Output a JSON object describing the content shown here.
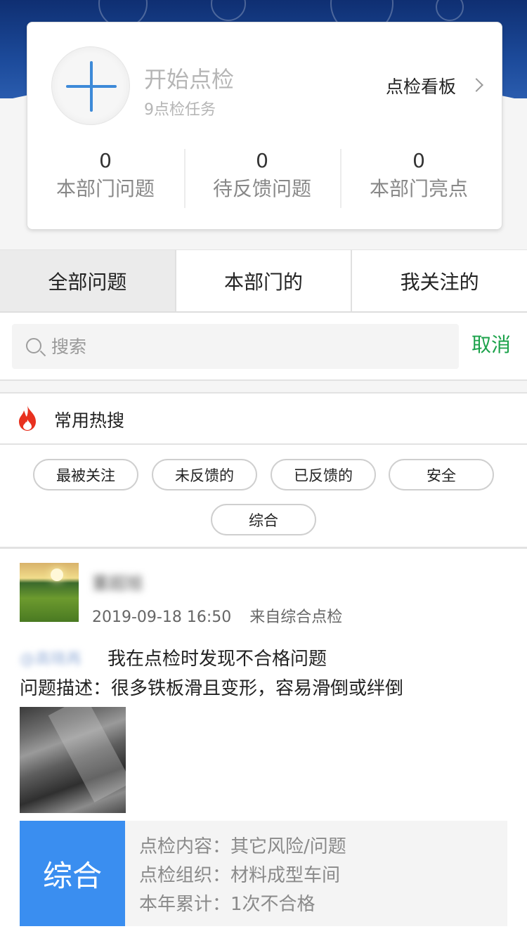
{
  "card": {
    "start_title": "开始点检",
    "task_count": "9点检任务",
    "board_label": "点检看板",
    "stats": [
      {
        "value": "0",
        "label": "本部门问题"
      },
      {
        "value": "0",
        "label": "待反馈问题"
      },
      {
        "value": "0",
        "label": "本部门亮点"
      }
    ]
  },
  "tabs": [
    {
      "label": "全部问题",
      "active": true
    },
    {
      "label": "本部门的",
      "active": false
    },
    {
      "label": "我关注的",
      "active": false
    }
  ],
  "search": {
    "placeholder": "搜索",
    "value": "",
    "cancel_label": "取消"
  },
  "hot_search": {
    "title": "常用热搜",
    "tags": [
      "最被关注",
      "未反馈的",
      "已反馈的",
      "安全",
      "综合"
    ]
  },
  "post": {
    "user_name": "董超旭",
    "timestamp": "2019-09-18 16:50",
    "source": "来自综合点检",
    "mention": "@高晓再",
    "text_line1": "我在点检时发现不合格问题",
    "text_line2": "问题描述：很多铁板滑且变形，容易滑倒或绊倒",
    "category_badge": "综合",
    "details": [
      "点检内容：其它风险/问题",
      "点检组织：材料成型车间",
      "本年累计：1次不合格"
    ]
  },
  "colors": {
    "accent_blue": "#3a8ef0",
    "cancel_green": "#1ba24a",
    "header_navy": "#1c4a9a",
    "fire_red": "#e8311f"
  }
}
